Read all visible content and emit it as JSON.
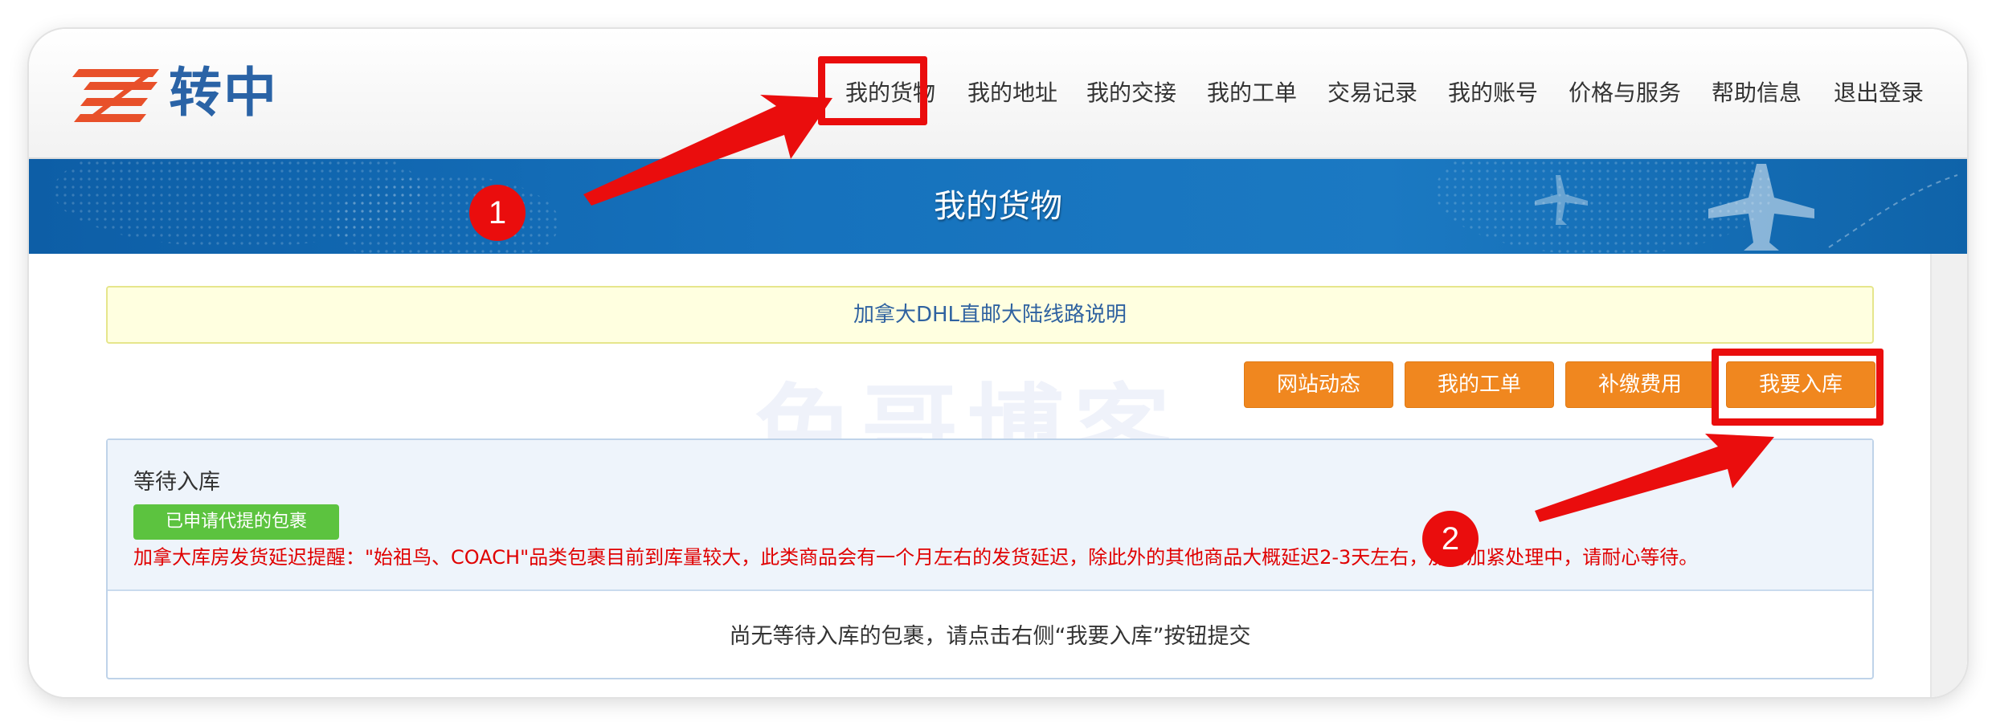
{
  "logo": {
    "text": "转中"
  },
  "nav": [
    {
      "label": "我的货物"
    },
    {
      "label": "我的地址"
    },
    {
      "label": "我的交接"
    },
    {
      "label": "我的工单"
    },
    {
      "label": "交易记录"
    },
    {
      "label": "我的账号"
    },
    {
      "label": "价格与服务"
    },
    {
      "label": "帮助信息"
    },
    {
      "label": "退出登录"
    }
  ],
  "banner": {
    "title": "我的货物"
  },
  "notice": {
    "text": "加拿大DHL直邮大陆线路说明"
  },
  "watermark": {
    "text": "兔哥博客"
  },
  "actions": [
    {
      "label": "网站动态"
    },
    {
      "label": "我的工单"
    },
    {
      "label": "补缴费用"
    },
    {
      "label": "我要入库"
    }
  ],
  "panel": {
    "title": "等待入库",
    "tag_button": "已申请代提的包裹",
    "warning": "加拿大库房发货延迟提醒：\"始祖鸟、COACH\"品类包裹目前到库量较大，此类商品会有一个月左右的发货延迟，除此外的其他商品大概延迟2-3天左右，加仓加紧处理中，请耐心等待。",
    "empty_message": "尚无等待入库的包裹，请点击右侧“我要入库”按钮提交"
  },
  "annotations": [
    {
      "number": "1"
    },
    {
      "number": "2"
    }
  ],
  "colors": {
    "brand_blue": "#2a63a6",
    "banner_blue": "#1672bd",
    "action_orange": "#f0871f",
    "tag_green": "#5cc33f",
    "warning_red": "#e00000",
    "annotation_red": "#ea0d0d"
  }
}
